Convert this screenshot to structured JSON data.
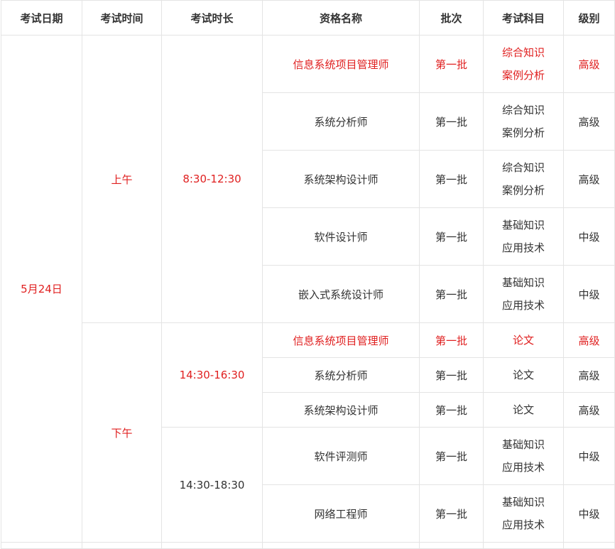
{
  "headers": [
    "考试日期",
    "考试时间",
    "考试时长",
    "资格名称",
    "批次",
    "考试科目",
    "级别"
  ],
  "date": "5月24日",
  "sessions": [
    {
      "time": "上午",
      "blocks": [
        {
          "duration": "8:30-12:30",
          "duration_color": "#e02020",
          "rows": [
            {
              "name": "信息系统项目管理师",
              "batch": "第一批",
              "subjects": [
                "综合知识",
                "案例分析"
              ],
              "level": "高级",
              "highlight": true
            },
            {
              "name": "系统分析师",
              "batch": "第一批",
              "subjects": [
                "综合知识",
                "案例分析"
              ],
              "level": "高级",
              "highlight": false
            },
            {
              "name": "系统架构设计师",
              "batch": "第一批",
              "subjects": [
                "综合知识",
                "案例分析"
              ],
              "level": "高级",
              "highlight": false
            },
            {
              "name": "软件设计师",
              "batch": "第一批",
              "subjects": [
                "基础知识",
                "应用技术"
              ],
              "level": "中级",
              "highlight": false
            },
            {
              "name": "嵌入式系统设计师",
              "batch": "第一批",
              "subjects": [
                "基础知识",
                "应用技术"
              ],
              "level": "中级",
              "highlight": false
            }
          ]
        }
      ]
    },
    {
      "time": "下午",
      "blocks": [
        {
          "duration": "14:30-16:30",
          "duration_color": "#e02020",
          "rows": [
            {
              "name": "信息系统项目管理师",
              "batch": "第一批",
              "subjects": [
                "论文"
              ],
              "level": "高级",
              "highlight": true
            },
            {
              "name": "系统分析师",
              "batch": "第一批",
              "subjects": [
                "论文"
              ],
              "level": "高级",
              "highlight": false
            },
            {
              "name": "系统架构设计师",
              "batch": "第一批",
              "subjects": [
                "论文"
              ],
              "level": "高级",
              "highlight": false
            }
          ]
        },
        {
          "duration": "14:30-18:30",
          "duration_color": "#333333",
          "rows": [
            {
              "name": "软件评测师",
              "batch": "第一批",
              "subjects": [
                "基础知识",
                "应用技术"
              ],
              "level": "中级",
              "highlight": false
            },
            {
              "name": "网络工程师",
              "batch": "第一批",
              "subjects": [
                "基础知识",
                "应用技术"
              ],
              "level": "中级",
              "highlight": false
            }
          ]
        }
      ]
    }
  ],
  "colors": {
    "highlight": "#e02020",
    "text": "#333333",
    "border": "#e4e4e4"
  }
}
